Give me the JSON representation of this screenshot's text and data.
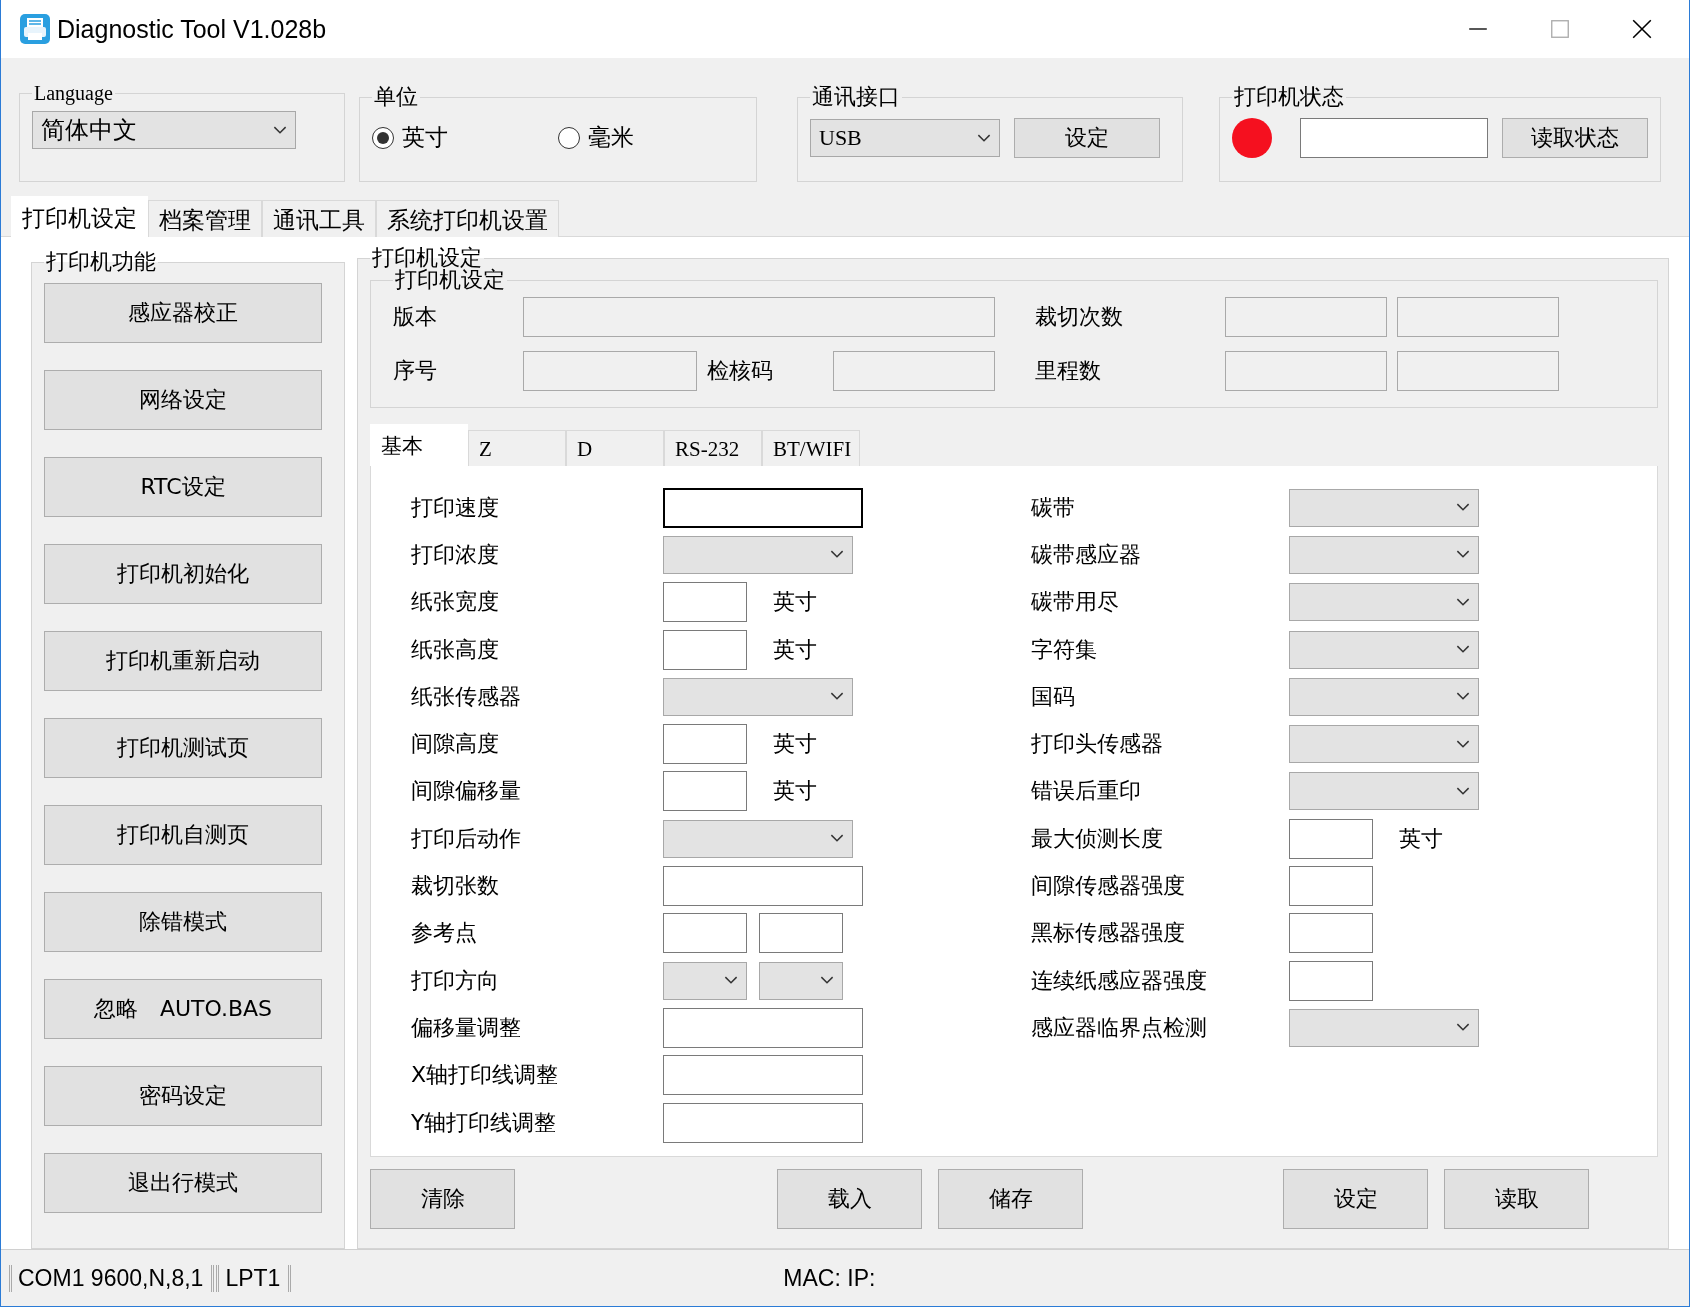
{
  "window": {
    "title": "Diagnostic Tool V1.028b"
  },
  "language": {
    "label": "Language",
    "value": "简体中文"
  },
  "unit": {
    "label": "单位",
    "options": [
      {
        "label": "英寸",
        "selected": true
      },
      {
        "label": "毫米",
        "selected": false
      }
    ]
  },
  "comm": {
    "label": "通讯接口",
    "value": "USB",
    "button": "设定"
  },
  "printer_status": {
    "label": "打印机状态",
    "connected": false,
    "button": "读取状态"
  },
  "tabs": [
    {
      "label": "打印机设定",
      "selected": true
    },
    {
      "label": "档案管理",
      "selected": false
    },
    {
      "label": "通讯工具",
      "selected": false
    },
    {
      "label": "系统打印机设置",
      "selected": false
    }
  ],
  "functions": {
    "title": "打印机功能",
    "buttons": [
      "感应器校正",
      "网络设定",
      "RTC设定",
      "打印机初始化",
      "打印机重新启动",
      "打印机测试页",
      "打印机自测页",
      "除错模式",
      "忽略　AUTO.BAS",
      "密码设定",
      "退出行模式"
    ]
  },
  "settings": {
    "title": "打印机设定",
    "info": {
      "title": "打印机设定",
      "version_label": "版本",
      "serial_label": "序号",
      "checksum_label": "检核码",
      "cut_count_label": "裁切次数",
      "mileage_label": "里程数"
    },
    "subtabs": [
      {
        "label": "基本",
        "selected": true
      },
      {
        "label": "Z",
        "selected": false
      },
      {
        "label": "D",
        "selected": false
      },
      {
        "label": "RS-232",
        "selected": false
      },
      {
        "label": "BT/WIFI",
        "selected": false
      }
    ],
    "left_fields": [
      {
        "label": "打印速度",
        "kind": "text"
      },
      {
        "label": "打印浓度",
        "kind": "combo"
      },
      {
        "label": "纸张宽度",
        "kind": "short",
        "unit": "英寸"
      },
      {
        "label": "纸张高度",
        "kind": "short",
        "unit": "英寸"
      },
      {
        "label": "纸张传感器",
        "kind": "combo"
      },
      {
        "label": "间隙高度",
        "kind": "short",
        "unit": "英寸"
      },
      {
        "label": "间隙偏移量",
        "kind": "short",
        "unit": "英寸"
      },
      {
        "label": "打印后动作",
        "kind": "combo"
      },
      {
        "label": "裁切张数",
        "kind": "text"
      },
      {
        "label": "参考点",
        "kind": "pair"
      },
      {
        "label": "打印方向",
        "kind": "combopair"
      },
      {
        "label": "偏移量调整",
        "kind": "text"
      },
      {
        "label": "X轴打印线调整",
        "kind": "text"
      },
      {
        "label": "Y轴打印线调整",
        "kind": "text"
      }
    ],
    "right_fields": [
      {
        "label": "碳带",
        "kind": "combo"
      },
      {
        "label": "碳带感应器",
        "kind": "combo"
      },
      {
        "label": "碳带用尽",
        "kind": "combo"
      },
      {
        "label": "字符集",
        "kind": "combo"
      },
      {
        "label": "国码",
        "kind": "combo"
      },
      {
        "label": "打印头传感器",
        "kind": "combo"
      },
      {
        "label": "错误后重印",
        "kind": "combo"
      },
      {
        "label": "最大侦测长度",
        "kind": "short",
        "unit": "英寸"
      },
      {
        "label": "间隙传感器强度",
        "kind": "short"
      },
      {
        "label": "黑标传感器强度",
        "kind": "short"
      },
      {
        "label": "连续纸感应器强度",
        "kind": "short"
      },
      {
        "label": "感应器临界点检测",
        "kind": "combo"
      }
    ],
    "buttons_left": [
      "清除"
    ],
    "buttons_mid": [
      "载入",
      "储存"
    ],
    "buttons_right": [
      "设定",
      "读取"
    ]
  },
  "status_bar": {
    "ports": [
      "COM1 9600,N,8,1",
      "LPT1"
    ],
    "network": "MAC: IP:"
  }
}
